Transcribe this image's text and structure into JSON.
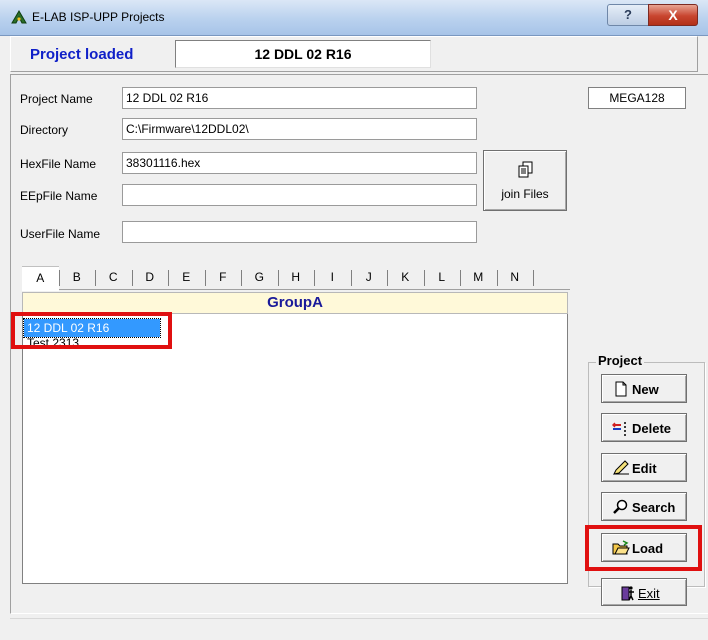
{
  "window": {
    "title": "E-LAB ISP-UPP Projects",
    "help_label": "?",
    "close_label": "X"
  },
  "header": {
    "status_label": "Project loaded",
    "loaded_project": "12 DDL 02 R16"
  },
  "device": {
    "name": "MEGA128"
  },
  "form": {
    "project_name": {
      "label": "Project Name",
      "value": "12 DDL 02 R16"
    },
    "directory": {
      "label": "Directory",
      "value": "C:\\Firmware\\12DDL02\\"
    },
    "hexfile": {
      "label": "HexFile Name",
      "value": "38301116.hex"
    },
    "eepfile": {
      "label": "EEpFile Name",
      "value": ""
    },
    "userfile": {
      "label": "UserFile Name",
      "value": ""
    }
  },
  "join_files": {
    "label": "join Files",
    "icon": "copy-files-icon"
  },
  "tabs": [
    "A",
    "B",
    "C",
    "D",
    "E",
    "F",
    "G",
    "H",
    "I",
    "J",
    "K",
    "L",
    "M",
    "N"
  ],
  "group": {
    "title": "GroupA",
    "items": [
      {
        "label": "12 DDL 02 R16",
        "selected": true
      },
      {
        "label": "Test 2313",
        "selected": false
      }
    ]
  },
  "project_panel": {
    "caption": "Project",
    "buttons": [
      {
        "label": "New",
        "icon": "new-document-icon"
      },
      {
        "label": "Delete",
        "icon": "delete-icon"
      },
      {
        "label": "Edit",
        "icon": "pencil-icon"
      },
      {
        "label": "Search",
        "icon": "magnifier-icon"
      },
      {
        "label": "Load",
        "icon": "open-folder-icon"
      }
    ]
  },
  "exit": {
    "label": "Exit",
    "icon": "exit-door-icon"
  },
  "colors": {
    "highlight": "#e01010",
    "selection": "#3399ff",
    "header_text": "#1020c8",
    "group_bg": "#fff9d9"
  }
}
